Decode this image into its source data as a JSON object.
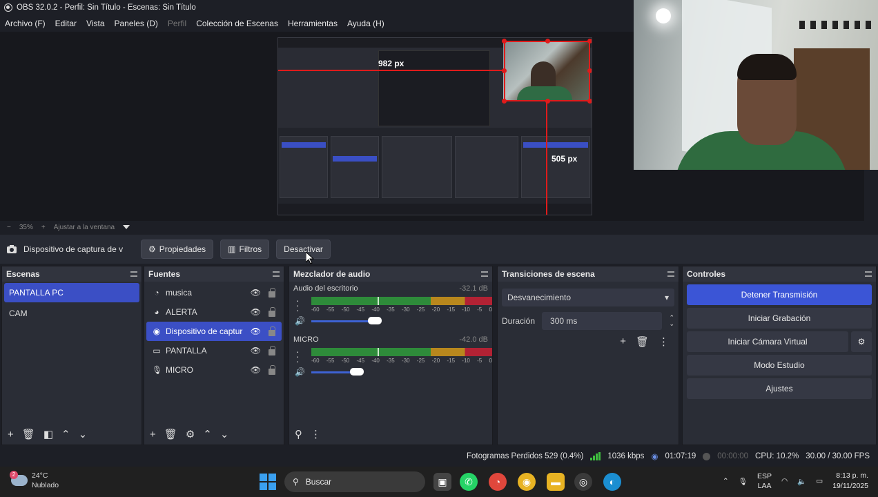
{
  "window": {
    "title": "OBS 32.0.2 - Perfil: Sin Título - Escenas: Sin Título"
  },
  "menu": [
    "Archivo (F)",
    "Editar",
    "Vista",
    "Paneles (D)",
    "Perfil",
    "Colección de Escenas",
    "Herramientas",
    "Ayuda (H)"
  ],
  "preview": {
    "label_h": "982 px",
    "label_v": "505 px"
  },
  "zoom": {
    "minus": "−",
    "value": "35%",
    "plus": "+",
    "fit": "Ajustar a la ventana"
  },
  "source_toolbar": {
    "name": "Dispositivo de captura de v",
    "properties": "Propiedades",
    "filters": "Filtros",
    "deactivate": "Desactivar"
  },
  "scenes": {
    "title": "Escenas",
    "items": [
      "PANTALLA PC",
      "CAM"
    ],
    "selected": 0
  },
  "sources": {
    "title": "Fuentes",
    "items": [
      {
        "label": "musica",
        "icon": "audio-icon"
      },
      {
        "label": "ALERTA",
        "icon": "browser-icon"
      },
      {
        "label": "Dispositivo de captur",
        "icon": "camera-icon"
      },
      {
        "label": "PANTALLA",
        "icon": "monitor-icon"
      },
      {
        "label": "MICRO",
        "icon": "mic-icon"
      }
    ],
    "selected": 2
  },
  "mixer": {
    "title": "Mezclador de audio",
    "ticks": [
      "-60",
      "-55",
      "-50",
      "-45",
      "-40",
      "-35",
      "-30",
      "-25",
      "-20",
      "-15",
      "-10",
      "-5",
      "0"
    ],
    "channels": [
      {
        "name": "Audio del escritorio",
        "db": "-32.1 dB",
        "volume": 0.84
      },
      {
        "name": "MICRO",
        "db": "-42.0 dB",
        "volume": 0.6
      }
    ]
  },
  "transitions": {
    "title": "Transiciones de escena",
    "selected": "Desvanecimiento",
    "duration_label": "Duración",
    "duration_value": "300 ms"
  },
  "controls": {
    "title": "Controles",
    "stop_stream": "Detener Transmisión",
    "start_recording": "Iniciar Grabación",
    "virtual_cam": "Iniciar Cámara Virtual",
    "studio_mode": "Modo Estudio",
    "settings": "Ajustes"
  },
  "status": {
    "dropped": "Fotogramas Perdidos 529 (0.4%)",
    "bitrate": "1036 kbps",
    "stream_time": "01:07:19",
    "rec_time": "00:00:00",
    "cpu": "CPU: 10.2%",
    "fps": "30.00 / 30.00 FPS"
  },
  "taskbar": {
    "temp": "24°C",
    "weather": "Nublado",
    "weather_badge": "2",
    "search": "Buscar",
    "lang1": "ESP",
    "lang2": "LAA",
    "time": "8:13 p. m.",
    "date": "19/11/2025"
  },
  "colors": {
    "accent": "#3b4fc5",
    "guide": "#e01b1b"
  }
}
